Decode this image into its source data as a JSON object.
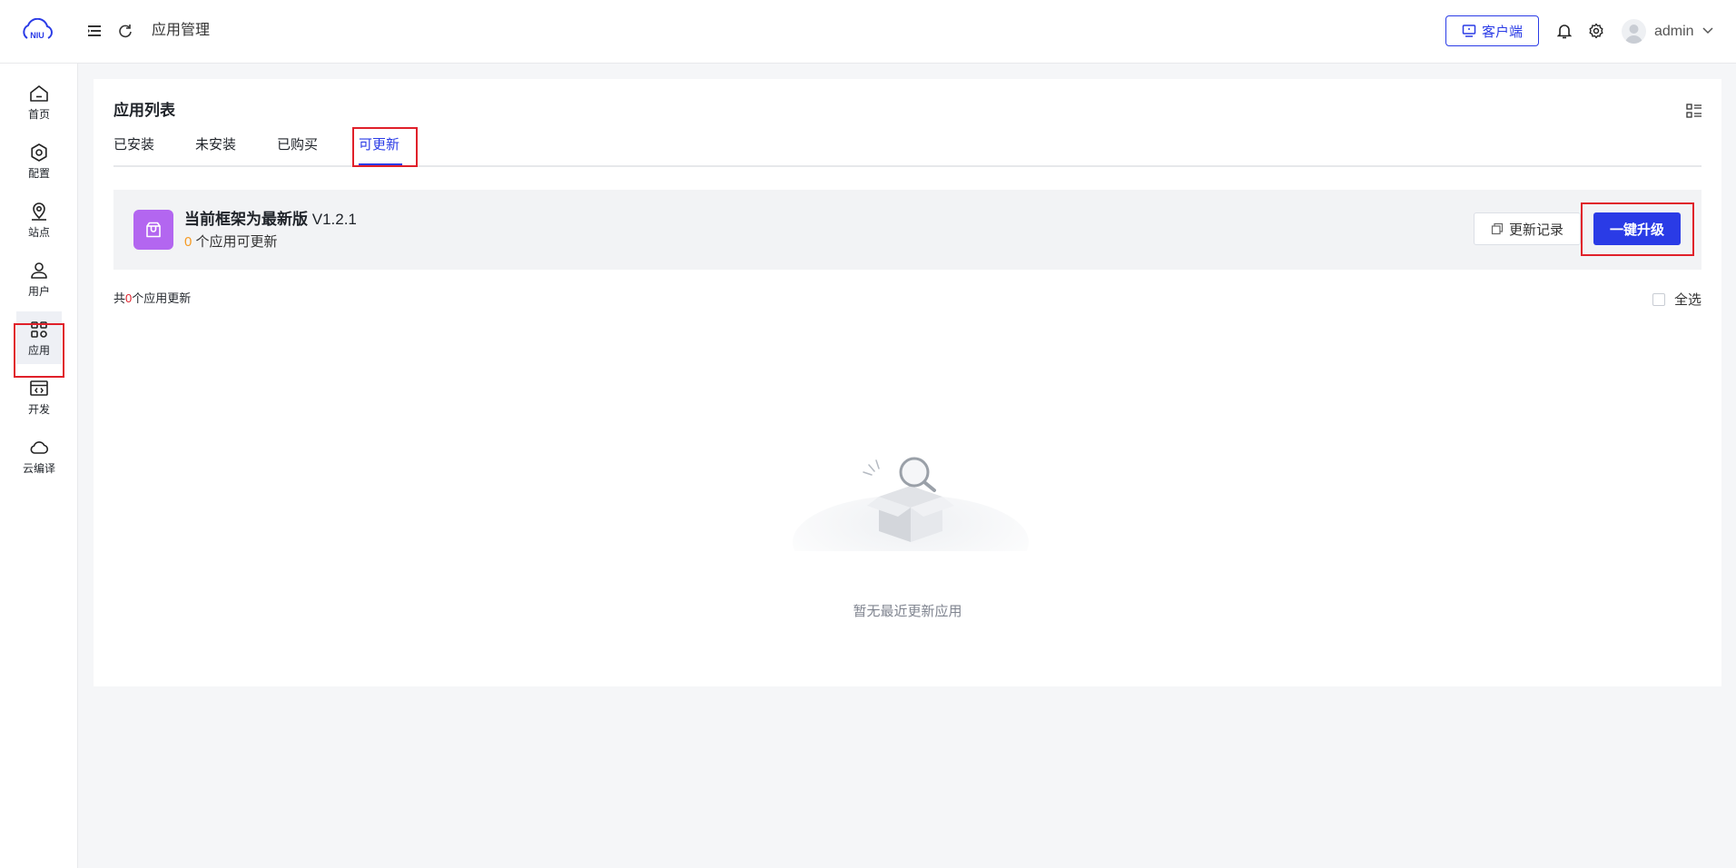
{
  "header": {
    "logo_text": "NIU",
    "breadcrumb": "应用管理",
    "client_button": "客户端",
    "user_name": "admin"
  },
  "sidebar": {
    "items": [
      {
        "label": "首页",
        "icon": "home-icon"
      },
      {
        "label": "配置",
        "icon": "settings-icon"
      },
      {
        "label": "站点",
        "icon": "location-icon"
      },
      {
        "label": "用户",
        "icon": "user-icon"
      },
      {
        "label": "应用",
        "icon": "apps-icon",
        "active": true
      },
      {
        "label": "开发",
        "icon": "code-window-icon"
      },
      {
        "label": "云编译",
        "icon": "cloud-icon"
      }
    ]
  },
  "main": {
    "title": "应用列表",
    "tabs": [
      {
        "label": "已安装"
      },
      {
        "label": "未安装"
      },
      {
        "label": "已购买"
      },
      {
        "label": "可更新",
        "active": true
      }
    ],
    "banner": {
      "title_prefix": "当前框架为最新版",
      "version": "V1.2.1",
      "sub_count": "0",
      "sub_text": "个应用可更新",
      "log_button": "更新记录",
      "upgrade_button": "一键升级"
    },
    "count_line": {
      "prefix": "共",
      "count": "0",
      "suffix": "个应用更新"
    },
    "select_all": "全选",
    "empty_text": "暂无最近更新应用"
  },
  "colors": {
    "primary": "#2a3be6",
    "highlight_box": "#e0202a",
    "app_icon_bg": "#b366f0",
    "count_orange": "#f59a23"
  }
}
